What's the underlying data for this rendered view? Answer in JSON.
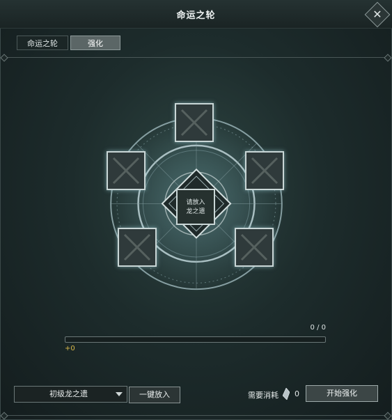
{
  "window": {
    "title": "命运之轮"
  },
  "tabs": [
    {
      "label": "命运之轮",
      "active": false
    },
    {
      "label": "强化",
      "active": true
    }
  ],
  "wheel": {
    "center_line1": "请放入",
    "center_line2": "龙之遗"
  },
  "progress": {
    "count_text": "0 / 0",
    "bonus_text": "+0",
    "fill_fraction": 0
  },
  "footer": {
    "select_value": "初级龙之遗",
    "put_button": "一键放入",
    "cost_label": "需要消耗",
    "cost_value": "0",
    "start_button": "开始强化"
  },
  "colors": {
    "accent_gold": "#d9b94a",
    "slot_border": "#c9d6d6"
  },
  "icons": {
    "close": "close-icon",
    "dropdown": "chevron-down-icon",
    "currency": "gem-icon"
  }
}
